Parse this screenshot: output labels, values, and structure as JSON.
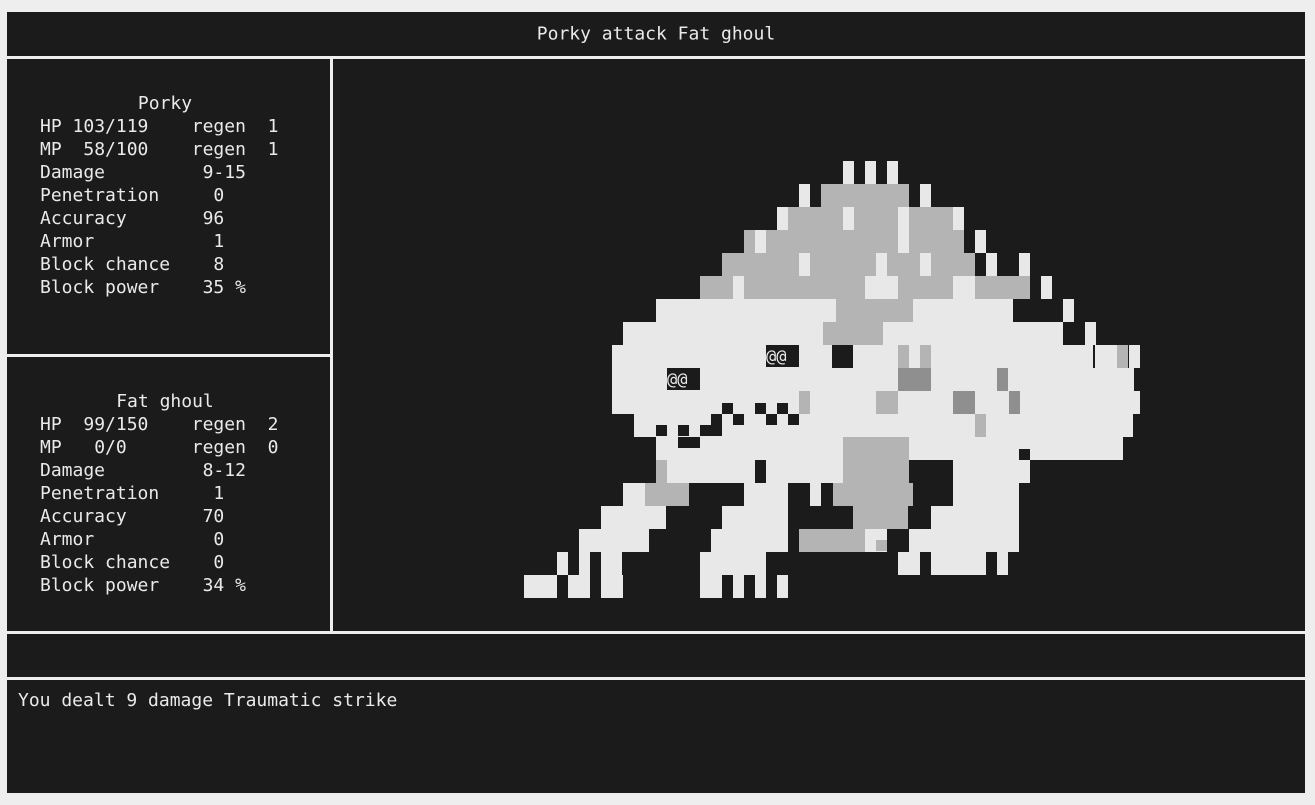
{
  "header": {
    "title": "Porky attack Fat ghoul"
  },
  "player": {
    "name": "Porky",
    "stats": [
      {
        "label": "HP",
        "value": "103/119",
        "extra": "regen  1"
      },
      {
        "label": "MP",
        "value": " 58/100",
        "extra": "regen  1"
      },
      {
        "label": "Damage",
        "value": "9-15",
        "extra": ""
      },
      {
        "label": "Penetration",
        "value": "0",
        "extra": ""
      },
      {
        "label": "Accuracy",
        "value": "96",
        "extra": ""
      },
      {
        "label": "Armor",
        "value": "1",
        "extra": ""
      },
      {
        "label": "Block chance",
        "value": "8",
        "extra": ""
      },
      {
        "label": "Block power",
        "value": "35 %",
        "extra": ""
      }
    ]
  },
  "enemy": {
    "name": "Fat ghoul",
    "stats": [
      {
        "label": "HP",
        "value": " 99/150",
        "extra": "regen  2"
      },
      {
        "label": "MP",
        "value": "  0/0",
        "extra": "regen  0"
      },
      {
        "label": "Damage",
        "value": "8-12",
        "extra": ""
      },
      {
        "label": "Penetration",
        "value": "1",
        "extra": ""
      },
      {
        "label": "Accuracy",
        "value": "70",
        "extra": ""
      },
      {
        "label": "Armor",
        "value": "0",
        "extra": ""
      },
      {
        "label": "Block chance",
        "value": "0",
        "extra": ""
      },
      {
        "label": "Block power",
        "value": "34 %",
        "extra": ""
      }
    ]
  },
  "monster": {
    "eye_glyph": "@@",
    "sprite": "fat-ghoul"
  },
  "action_bar": {
    "text": ""
  },
  "log": {
    "lines": [
      "You dealt 9 damage Traumatic strike"
    ]
  },
  "colors": {
    "background": "#1b1b1b",
    "text": "#eaeaea",
    "frame": "#eeeeee",
    "sprite_light": "#e8e8e8",
    "sprite_mid": "#b4b4b4",
    "sprite_dark": "#8f8f8f"
  }
}
